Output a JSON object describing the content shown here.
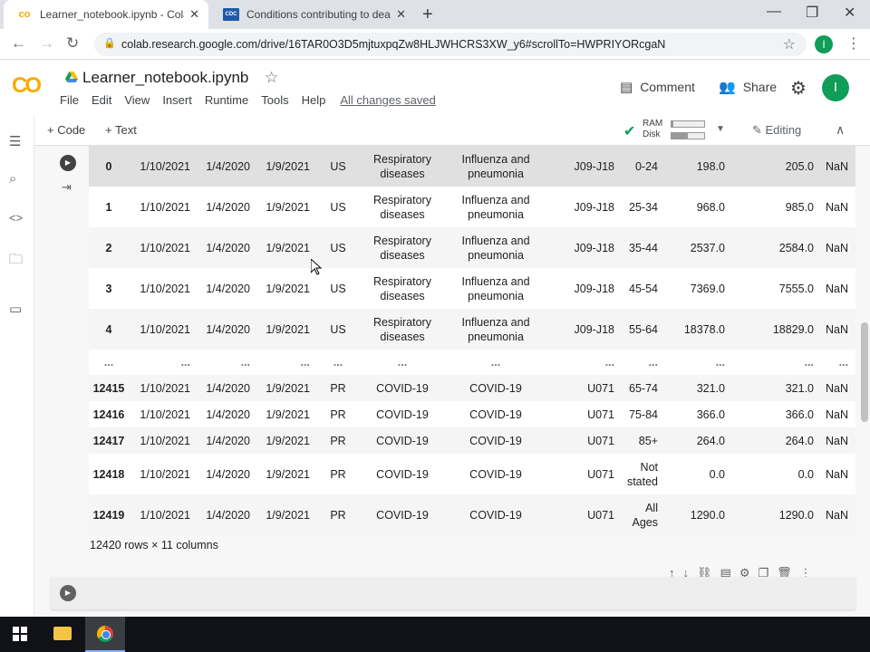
{
  "browser": {
    "tabs": [
      {
        "title": "Learner_notebook.ipynb - Colab",
        "favicon": "colab-logo-icon"
      },
      {
        "title": "Conditions contributing to death",
        "favicon": "cdc-logo-icon"
      }
    ],
    "url": "colab.research.google.com/drive/16TAR0O3D5mjtuxpqZw8HLJWHCRS3XW_y6#scrollTo=HWPRIYORcgaN",
    "profile_initial": "I"
  },
  "colab": {
    "logo": "CO",
    "notebook_name": "Learner_notebook.ipynb",
    "menu": [
      "File",
      "Edit",
      "View",
      "Insert",
      "Runtime",
      "Tools",
      "Help"
    ],
    "save_status": "All changes saved",
    "comment_label": "Comment",
    "share_label": "Share",
    "user_initial": "I"
  },
  "toolbar": {
    "code_label": "+ Code",
    "text_label": "+ Text",
    "ram_label": "RAM",
    "disk_label": "Disk",
    "ram_fraction": 0.05,
    "disk_fraction": 0.5,
    "editing_label": "Editing"
  },
  "dataframe": {
    "rows": [
      [
        "0",
        "1/10/2021",
        "1/4/2020",
        "1/9/2021",
        "US",
        "Respiratory diseases",
        "Influenza and pneumonia",
        "J09-J18",
        "0-24",
        "198.0",
        "205.0",
        "NaN"
      ],
      [
        "1",
        "1/10/2021",
        "1/4/2020",
        "1/9/2021",
        "US",
        "Respiratory diseases",
        "Influenza and pneumonia",
        "J09-J18",
        "25-34",
        "968.0",
        "985.0",
        "NaN"
      ],
      [
        "2",
        "1/10/2021",
        "1/4/2020",
        "1/9/2021",
        "US",
        "Respiratory diseases",
        "Influenza and pneumonia",
        "J09-J18",
        "35-44",
        "2537.0",
        "2584.0",
        "NaN"
      ],
      [
        "3",
        "1/10/2021",
        "1/4/2020",
        "1/9/2021",
        "US",
        "Respiratory diseases",
        "Influenza and pneumonia",
        "J09-J18",
        "45-54",
        "7369.0",
        "7555.0",
        "NaN"
      ],
      [
        "4",
        "1/10/2021",
        "1/4/2020",
        "1/9/2021",
        "US",
        "Respiratory diseases",
        "Influenza and pneumonia",
        "J09-J18",
        "55-64",
        "18378.0",
        "18829.0",
        "NaN"
      ],
      [
        "...",
        "...",
        "...",
        "...",
        "...",
        "...",
        "...",
        "...",
        "...",
        "...",
        "...",
        "..."
      ],
      [
        "12415",
        "1/10/2021",
        "1/4/2020",
        "1/9/2021",
        "PR",
        "COVID-19",
        "COVID-19",
        "U071",
        "65-74",
        "321.0",
        "321.0",
        "NaN"
      ],
      [
        "12416",
        "1/10/2021",
        "1/4/2020",
        "1/9/2021",
        "PR",
        "COVID-19",
        "COVID-19",
        "U071",
        "75-84",
        "366.0",
        "366.0",
        "NaN"
      ],
      [
        "12417",
        "1/10/2021",
        "1/4/2020",
        "1/9/2021",
        "PR",
        "COVID-19",
        "COVID-19",
        "U071",
        "85+",
        "264.0",
        "264.0",
        "NaN"
      ],
      [
        "12418",
        "1/10/2021",
        "1/4/2020",
        "1/9/2021",
        "PR",
        "COVID-19",
        "COVID-19",
        "U071",
        "Not stated",
        "0.0",
        "0.0",
        "NaN"
      ],
      [
        "12419",
        "1/10/2021",
        "1/4/2020",
        "1/9/2021",
        "PR",
        "COVID-19",
        "COVID-19",
        "U071",
        "All Ages",
        "1290.0",
        "1290.0",
        "NaN"
      ]
    ],
    "shape_text": "12420 rows × 11 columns"
  }
}
